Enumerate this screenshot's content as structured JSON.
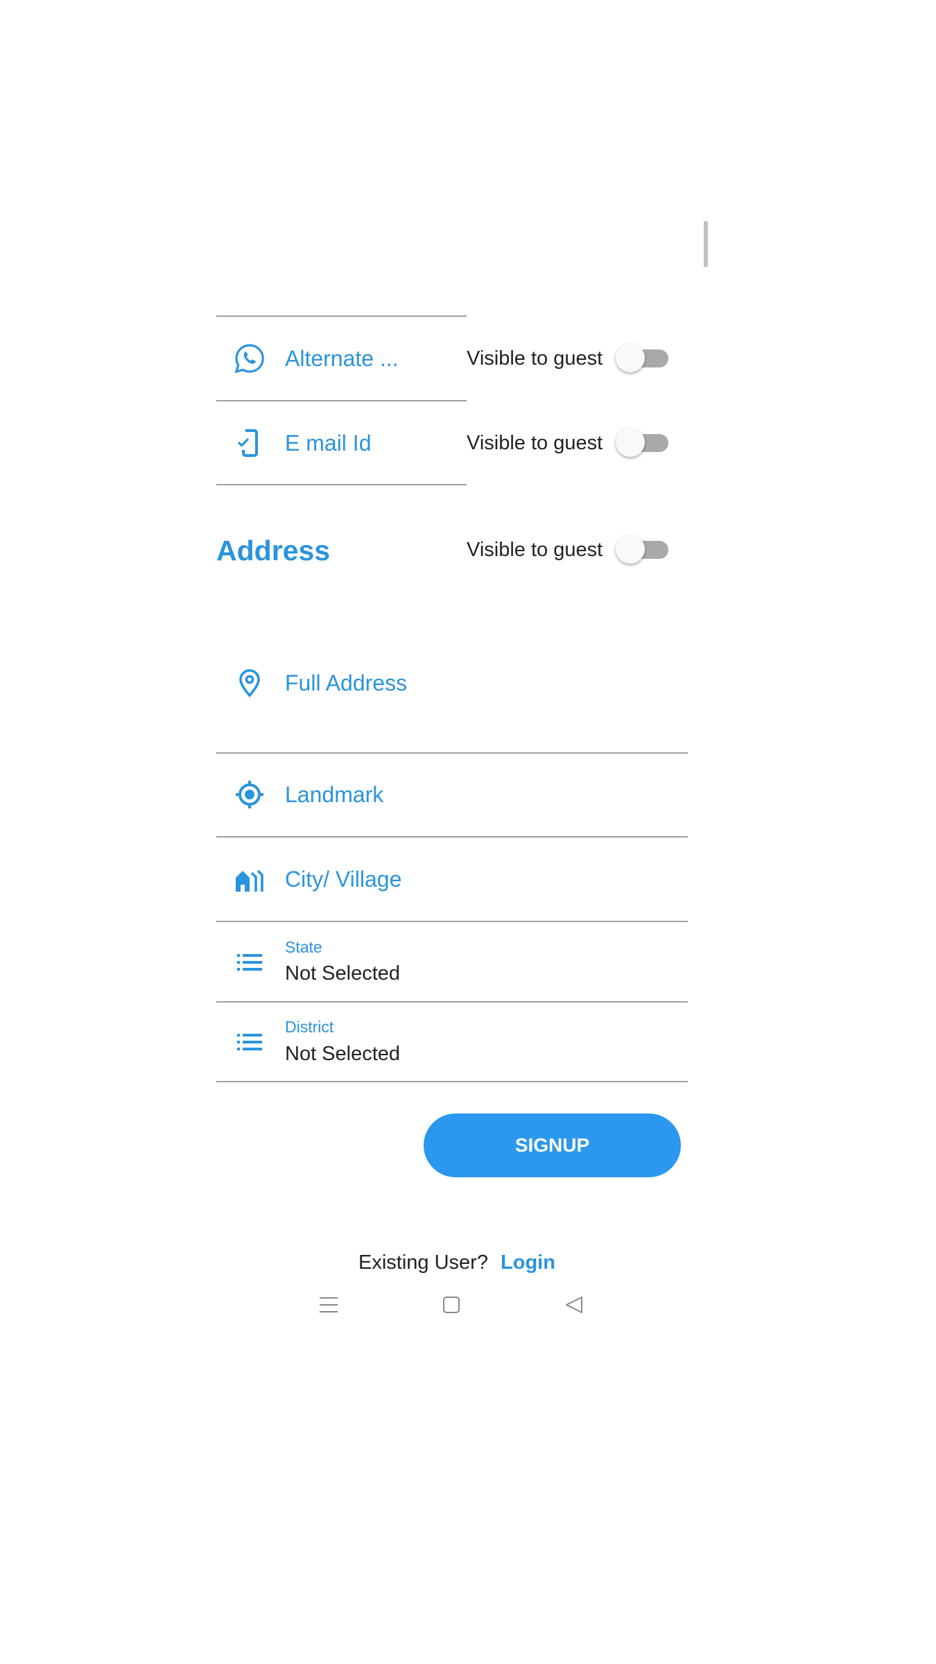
{
  "colors": {
    "accent": "#2a94dc",
    "text": "#222222",
    "divider": "#9e9e9e",
    "toggle_off_track": "#a9a9a9"
  },
  "contact": {
    "alternate": {
      "label": "Alternate ...",
      "icon": "whatsapp-icon",
      "visibility_label": "Visible to guest",
      "visible": false
    },
    "email": {
      "label": "E mail Id",
      "icon": "phone-check-icon",
      "visibility_label": "Visible to guest",
      "visible": false
    }
  },
  "address": {
    "heading": "Address",
    "visibility_label": "Visible to guest",
    "visible": false,
    "full_address": {
      "label": "Full Address",
      "icon": "location-pin-icon"
    },
    "landmark": {
      "label": "Landmark",
      "icon": "gps-target-icon"
    },
    "city": {
      "label": "City/ Village",
      "icon": "city-icon"
    },
    "state": {
      "label": "State",
      "value": "Not Selected",
      "icon": "list-icon"
    },
    "district": {
      "label": "District",
      "value": "Not Selected",
      "icon": "list-icon"
    }
  },
  "signup_label": "SIGNUP",
  "footer": {
    "prompt": "Existing User?",
    "login": "Login"
  },
  "navbar": {
    "icons": [
      "menu-icon",
      "home-square-icon",
      "back-triangle-icon"
    ]
  }
}
